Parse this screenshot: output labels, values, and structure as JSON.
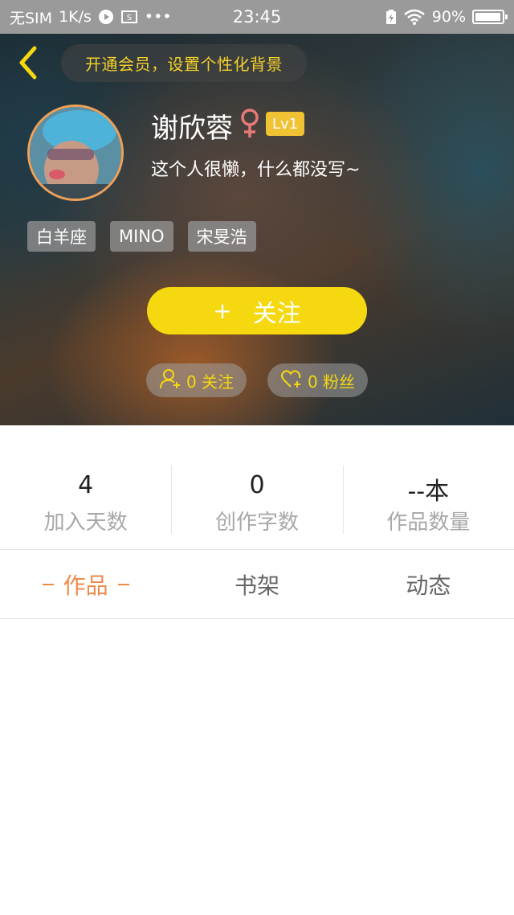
{
  "status_bar": {
    "carrier": "无SIM",
    "speed": "1K/s",
    "more": "•••",
    "time": "23:45",
    "battery": "90%"
  },
  "header": {
    "vip_banner": "开通会员，设置个性化背景",
    "username": "谢欣蓉",
    "gender_symbol": "♀",
    "level": "Lv1",
    "bio": "这个人很懒，什么都没写~",
    "tags": [
      "白羊座",
      "MINO",
      "宋旻浩"
    ],
    "follow_label": "关注",
    "follow_plus": "+",
    "following_count": "0 关注",
    "fans_count": "0 粉丝"
  },
  "stats": [
    {
      "value": "4",
      "label": "加入天数"
    },
    {
      "value": "0",
      "label": "创作字数"
    },
    {
      "value": "--本",
      "label": "作品数量"
    }
  ],
  "tabs": [
    "作品",
    "书架",
    "动态"
  ],
  "colors": {
    "accent_yellow": "#f5d80f",
    "accent_orange": "#f08a4b",
    "level_badge": "#f1c233",
    "gender_pink": "#e8797a"
  }
}
